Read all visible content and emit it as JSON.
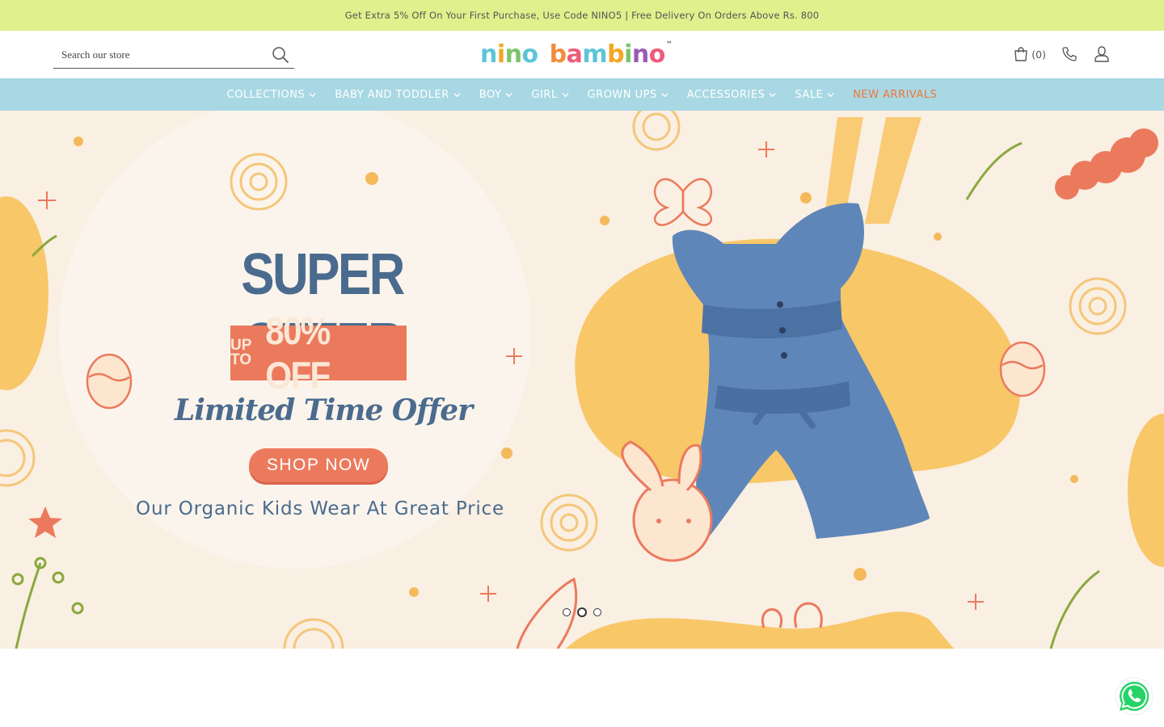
{
  "announcement": {
    "text": "Get Extra 5% Off On Your First Purchase, Use Code NINO5 | Free Delivery On Orders Above Rs. 800"
  },
  "header": {
    "search_placeholder": "Search our store",
    "logo": {
      "word1": "nino",
      "word2": "bambino",
      "tm": "™"
    },
    "cart_count": "(0)"
  },
  "nav": {
    "items": [
      {
        "label": "COLLECTIONS",
        "dropdown": true
      },
      {
        "label": "BABY AND TODDLER",
        "dropdown": true
      },
      {
        "label": "BOY",
        "dropdown": true
      },
      {
        "label": "GIRL",
        "dropdown": true
      },
      {
        "label": "GROWN UPS",
        "dropdown": true
      },
      {
        "label": "ACCESSORIES",
        "dropdown": true
      },
      {
        "label": "SALE",
        "dropdown": true
      },
      {
        "label": "NEW ARRIVALS",
        "dropdown": false
      }
    ]
  },
  "hero": {
    "title": "SUPER OFFER",
    "badge_upto_line1": "UP",
    "badge_upto_line2": "TO",
    "badge_percent": "80% OFF",
    "subtitle": "Limited Time Offer",
    "cta": "SHOP NOW",
    "tagline": "Our Organic Kids Wear At Great Price",
    "slides": 3,
    "active_slide": 2
  },
  "colors": {
    "announcement_bg": "#e0f08c",
    "nav_bg": "#a8d8e3",
    "highlight": "#f0763c",
    "hero_bg": "#faefe3",
    "accent_coral": "#eb7a5d",
    "accent_blue": "#4a6b8e",
    "blob_yellow": "#f8c768"
  },
  "icons": [
    "search-icon",
    "cart-icon",
    "phone-icon",
    "user-icon",
    "chevron-down-icon",
    "whatsapp-icon"
  ]
}
